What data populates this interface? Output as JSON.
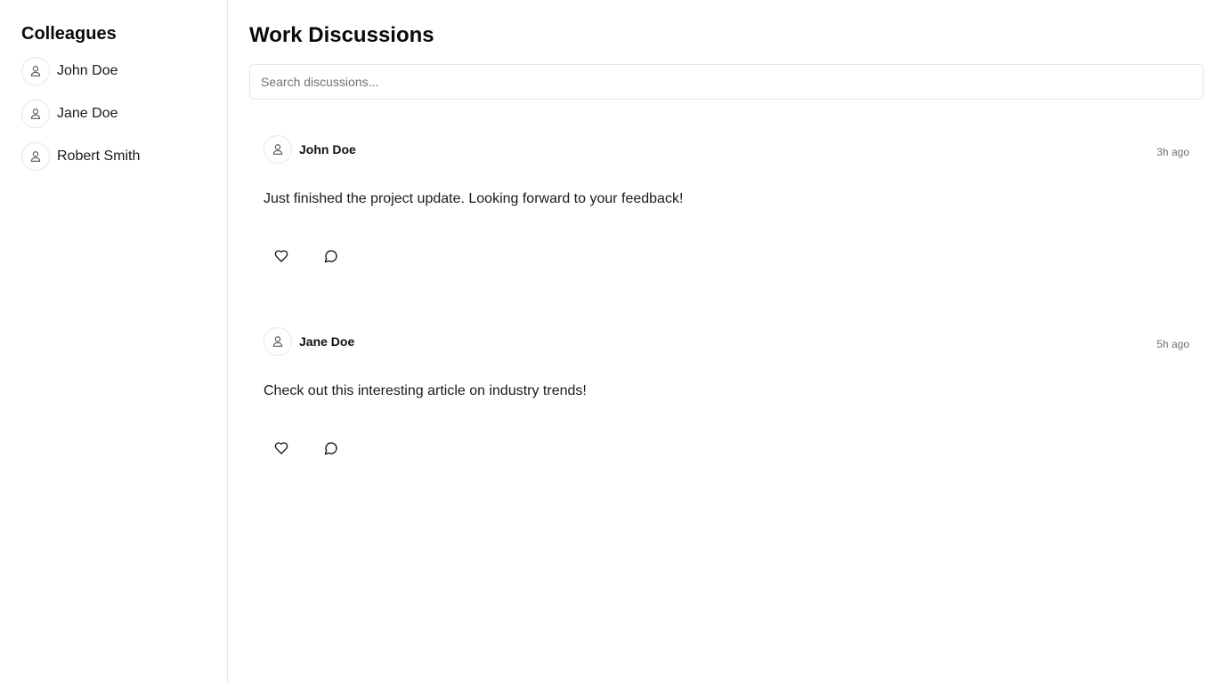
{
  "sidebar": {
    "title": "Colleagues",
    "colleagues": [
      {
        "name": "John Doe",
        "icon": "user-icon"
      },
      {
        "name": "Jane Doe",
        "icon": "user-icon"
      },
      {
        "name": "Robert Smith",
        "icon": "user-icon"
      }
    ]
  },
  "main": {
    "title": "Work Discussions",
    "search": {
      "placeholder": "Search discussions...",
      "value": ""
    },
    "posts": [
      {
        "author": "John Doe",
        "time": "3h ago",
        "body": "Just finished the project update. Looking forward to your feedback!",
        "actions": [
          "heart-icon",
          "comment-icon"
        ]
      },
      {
        "author": "Jane Doe",
        "time": "5h ago",
        "body": "Check out this interesting article on industry trends!",
        "actions": [
          "heart-icon",
          "comment-icon"
        ]
      }
    ]
  },
  "colors": {
    "border": "#e5e7eb",
    "muted_text": "#6b7280",
    "text": "#111111"
  }
}
